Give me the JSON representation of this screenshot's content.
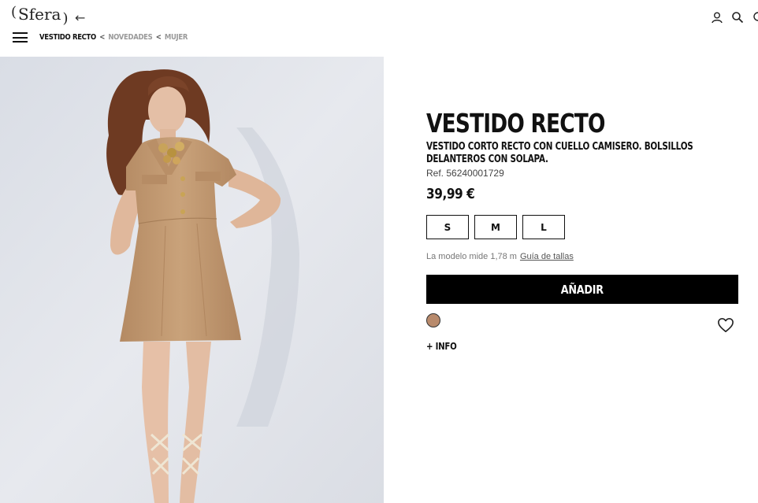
{
  "header": {
    "logo_text": "Sfera",
    "breadcrumb": {
      "current": "VESTIDO RECTO",
      "sep1": "<",
      "level1": "NOVEDADES",
      "sep2": "<",
      "level2": "MUJER"
    },
    "icons": [
      "back-arrow-icon",
      "menu-icon",
      "user-icon",
      "search-icon",
      "bag-icon"
    ]
  },
  "product": {
    "title": "VESTIDO RECTO",
    "description": "VESTIDO CORTO RECTO CON CUELLO CAMISERO. BOLSILLOS DELANTEROS CON SOLAPA.",
    "ref": "Ref. 56240001729",
    "price": "39,99 €",
    "sizes": [
      "S",
      "M",
      "L"
    ],
    "model_note": "La modelo mide 1,78 m",
    "size_guide": "Guía de tallas",
    "add_button": "AÑADIR",
    "swatch_color": "#b88a6c",
    "more_info": "+ INFO"
  },
  "colors": {
    "photo_background": "#e3e6ec",
    "dress": "#c59d76",
    "button_background": "#000000"
  }
}
